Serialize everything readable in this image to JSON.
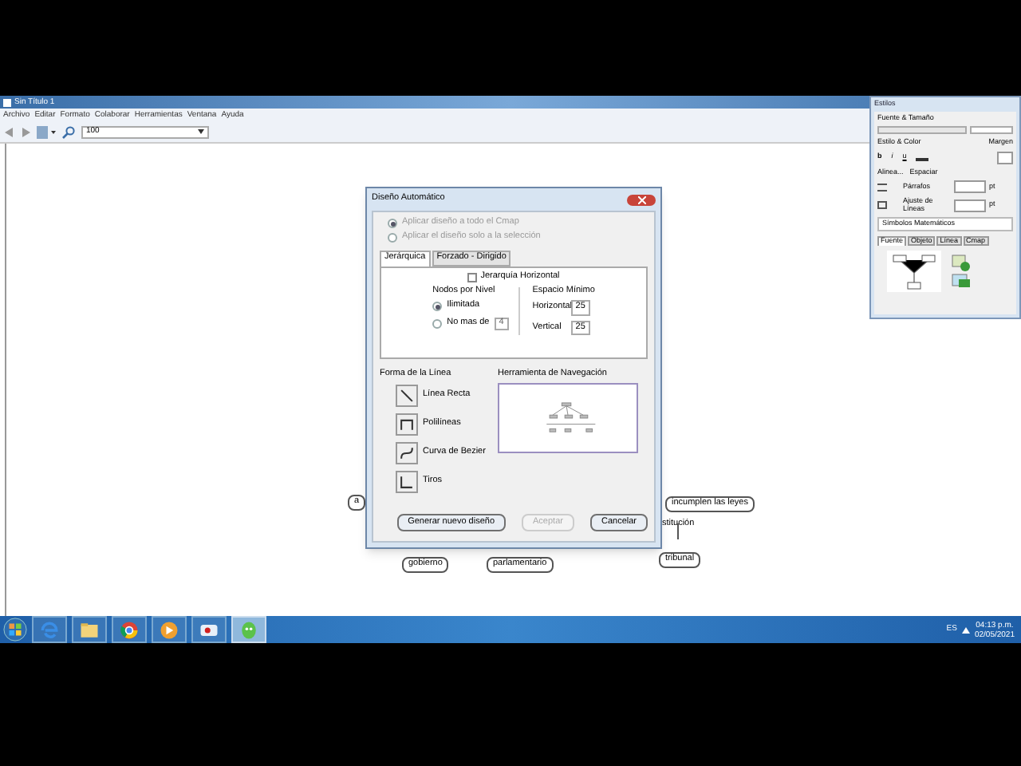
{
  "app": {
    "title": "Sin Título 1",
    "menu": [
      "Archivo",
      "Editar",
      "Formato",
      "Colaborar",
      "Herramientas",
      "Ventana",
      "Ayuda"
    ],
    "zoom": "100"
  },
  "nodes": [
    {
      "kind": "box",
      "text": "a"
    },
    {
      "kind": "box",
      "text": "incumplen las leyes"
    },
    {
      "kind": "label",
      "text": "stitución"
    },
    {
      "kind": "box",
      "text": "gobierno"
    },
    {
      "kind": "box",
      "text": "parlamentario"
    },
    {
      "kind": "box",
      "text": "tribunal"
    }
  ],
  "dialog": {
    "title": "Diseño Automático",
    "scope": [
      {
        "label": "Aplicar diseño a todo el Cmap",
        "selected": true,
        "disabled": true
      },
      {
        "label": "Aplicar el diseño solo a la selección",
        "selected": false,
        "disabled": true
      }
    ],
    "tabs": [
      {
        "label": "Jerárquica",
        "selected": true
      },
      {
        "label": "Forzado - Dirigido",
        "selected": false
      }
    ],
    "horizontal_check": {
      "label": "Jerarquía Horizontal",
      "checked": false
    },
    "nodes_per_level": {
      "title": "Nodos por Nivel",
      "options": [
        {
          "label": "Ilimitada",
          "selected": true
        },
        {
          "label": "No mas de",
          "selected": false,
          "value": "4"
        }
      ]
    },
    "spacing": {
      "title": "Espacio Mínimo",
      "fields": [
        {
          "label": "Horizontal",
          "value": "25"
        },
        {
          "label": "Vertical",
          "value": "25"
        }
      ]
    },
    "line_shape": {
      "title": "Forma de la Línea",
      "options": [
        {
          "kind": "straight",
          "label": "Línea Recta"
        },
        {
          "kind": "poly",
          "label": "Polilíneas"
        },
        {
          "kind": "curve",
          "label": "Curva de Bezier"
        },
        {
          "kind": "elbow",
          "label": "Tiros"
        }
      ]
    },
    "navigator": {
      "title": "Herramienta de Navegación"
    },
    "buttons": [
      {
        "label": "Generar nuevo diseño",
        "disabled": false
      },
      {
        "label": "Aceptar",
        "disabled": true
      },
      {
        "label": "Cancelar",
        "disabled": false
      }
    ]
  },
  "styles": {
    "title": "Estilos",
    "font_section": "Fuente & Tamaño",
    "style_section": "Estilo & Color",
    "bold": "b",
    "italic": "i",
    "underline": "u",
    "margin_section": "Margen",
    "align_section": "Alinea...",
    "spacing_section": "Espaciar",
    "paragraphs": "Párrafos",
    "line_fit": "Ajuste de Líneas",
    "unit_paragraphs": "pt",
    "unit_line_fit": "pt",
    "math": "Símbolos Matemáticos",
    "tabs": [
      {
        "label": "Fuente",
        "selected": true
      },
      {
        "label": "Objeto",
        "selected": false
      },
      {
        "label": "Línea",
        "selected": false
      },
      {
        "label": "Cmap",
        "selected": false
      }
    ]
  },
  "taskbar": {
    "apps": [
      {
        "kind": "ie",
        "selected": false
      },
      {
        "kind": "folder",
        "selected": false
      },
      {
        "kind": "chrome",
        "selected": false
      },
      {
        "kind": "media",
        "selected": false
      },
      {
        "kind": "camera",
        "selected": false
      },
      {
        "kind": "cmap",
        "selected": true
      }
    ],
    "language": "ES",
    "time": "04:13 p.m.",
    "date": "02/05/2021"
  }
}
